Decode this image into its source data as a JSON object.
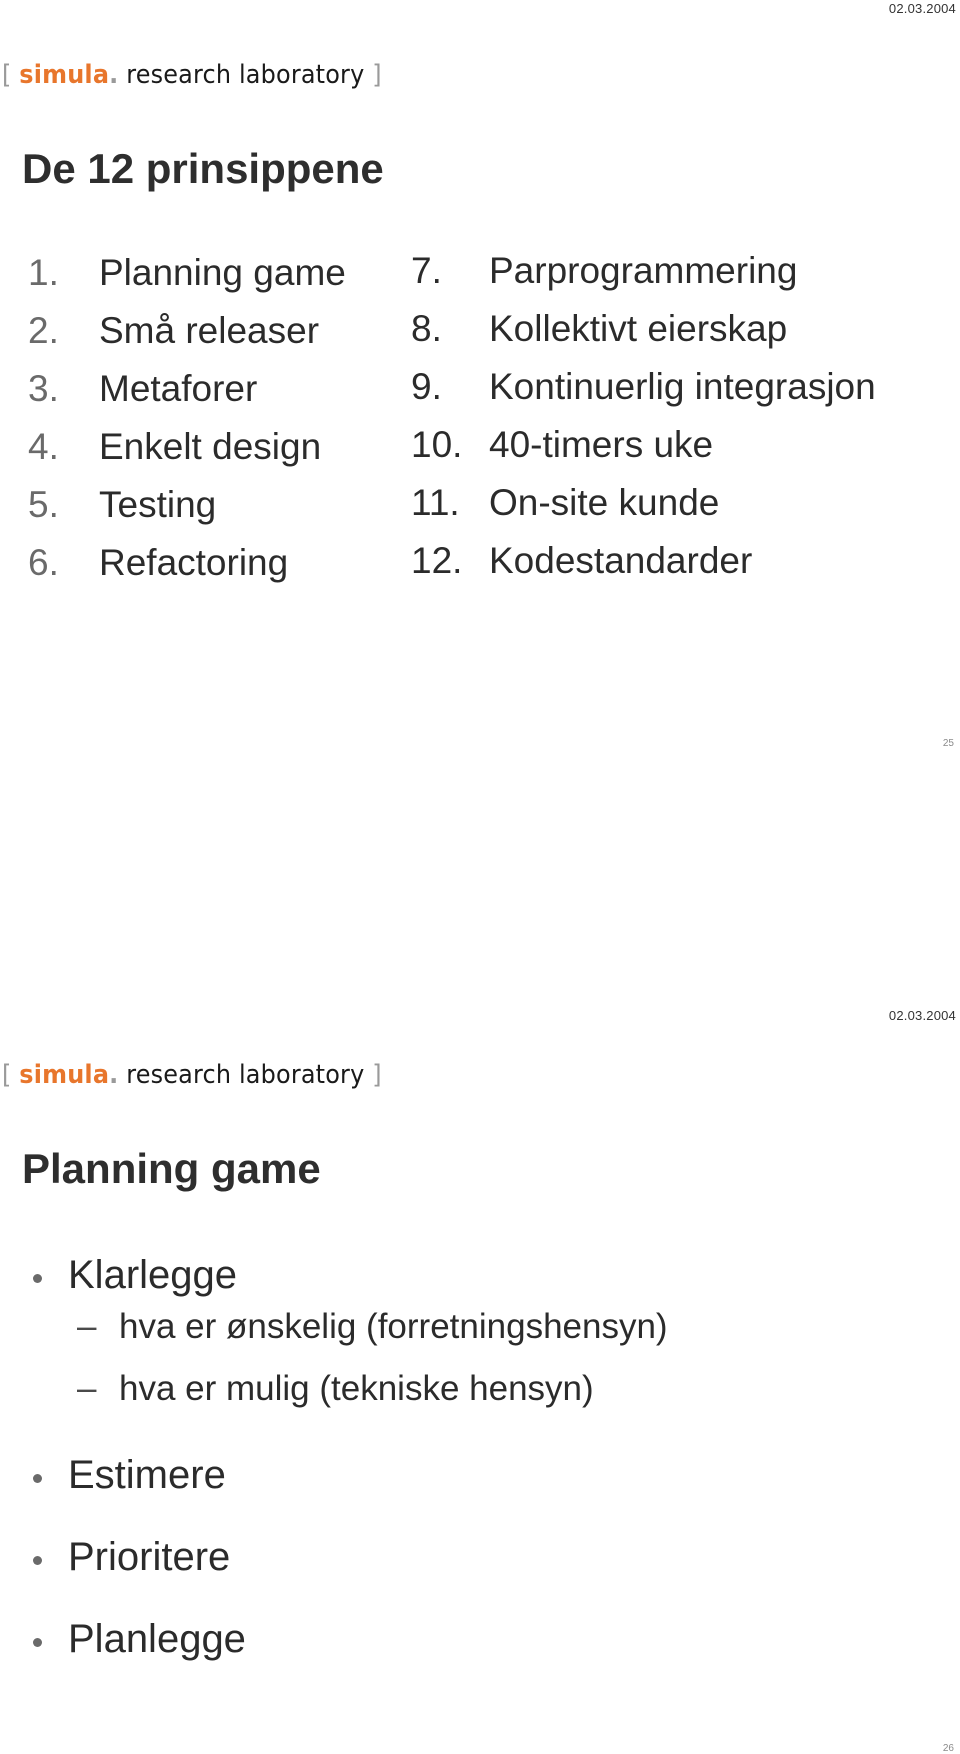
{
  "slides": [
    {
      "date": "02.03.2004",
      "logo": {
        "open_bracket": "[",
        "brand": "simula",
        "dot": ".",
        "suffix": "research laboratory",
        "close_bracket": "]"
      },
      "title": "De 12 prinsippene",
      "left_column": [
        {
          "num": "1.",
          "text": "Planning game"
        },
        {
          "num": "2.",
          "text": "Små releaser"
        },
        {
          "num": "3.",
          "text": "Metaforer"
        },
        {
          "num": "4.",
          "text": "Enkelt design"
        },
        {
          "num": "5.",
          "text": "Testing"
        },
        {
          "num": "6.",
          "text": "Refactoring"
        }
      ],
      "right_column": [
        {
          "num": "7.",
          "text": "Parprogrammering"
        },
        {
          "num": "8.",
          "text": "Kollektivt eierskap"
        },
        {
          "num": "9.",
          "text": "Kontinuerlig integrasjon"
        },
        {
          "num": "10.",
          "text": "40-timers uke"
        },
        {
          "num": "11.",
          "text": "On-site kunde"
        },
        {
          "num": "12.",
          "text": "Kodestandarder"
        }
      ],
      "page_number": "25"
    },
    {
      "date": "02.03.2004",
      "logo": {
        "open_bracket": "[",
        "brand": "simula",
        "dot": ".",
        "suffix": "research laboratory",
        "close_bracket": "]"
      },
      "title": "Planning game",
      "bullets": [
        {
          "text": "Klarlegge",
          "sub": [
            {
              "dash": "–",
              "text": "hva er ønskelig (forretningshensyn)"
            },
            {
              "dash": "–",
              "text": "hva er mulig (tekniske hensyn)"
            }
          ]
        },
        {
          "text": "Estimere"
        },
        {
          "text": "Prioritere"
        },
        {
          "text": "Planlegge"
        }
      ],
      "page_number": "26"
    }
  ],
  "colors": {
    "brand_orange": "#e8762c",
    "bracket_gray": "#9a9a9a",
    "text_dark": "#2b2b2b",
    "number_gray": "#6a6a6a"
  }
}
